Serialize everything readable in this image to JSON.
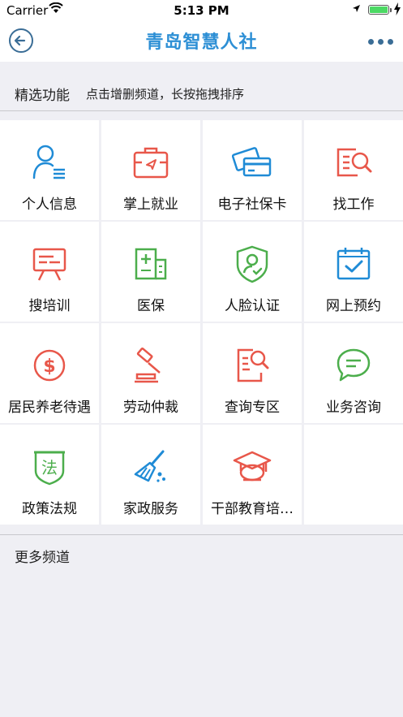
{
  "status": {
    "carrier": "Carrier",
    "time": "5:13 PM"
  },
  "nav": {
    "title": "青岛智慧人社"
  },
  "featured": {
    "title": "精选功能",
    "hint": "点击增删频道，长按拖拽排序",
    "items": [
      {
        "label": "个人信息",
        "icon": "person-info-icon"
      },
      {
        "label": "掌上就业",
        "icon": "briefcase-icon"
      },
      {
        "label": "电子社保卡",
        "icon": "card-icon"
      },
      {
        "label": "找工作",
        "icon": "search-doc-icon"
      },
      {
        "label": "搜培训",
        "icon": "training-board-icon"
      },
      {
        "label": "医保",
        "icon": "hospital-icon"
      },
      {
        "label": "人脸认证",
        "icon": "face-shield-icon"
      },
      {
        "label": "网上预约",
        "icon": "calendar-check-icon"
      },
      {
        "label": "居民养老待遇",
        "icon": "dollar-icon"
      },
      {
        "label": "劳动仲裁",
        "icon": "gavel-icon"
      },
      {
        "label": "查询专区",
        "icon": "doc-search-icon"
      },
      {
        "label": "业务咨询",
        "icon": "chat-icon"
      },
      {
        "label": "政策法规",
        "icon": "law-icon"
      },
      {
        "label": "家政服务",
        "icon": "broom-icon"
      },
      {
        "label": "干部教育培…",
        "icon": "graduation-cap-icon"
      }
    ]
  },
  "more": {
    "title": "更多频道"
  },
  "colors": {
    "accent": "#2d8fd5",
    "blue_icon": "#1f8bd6",
    "red_icon": "#e8574a",
    "green_icon": "#4cae4c"
  }
}
